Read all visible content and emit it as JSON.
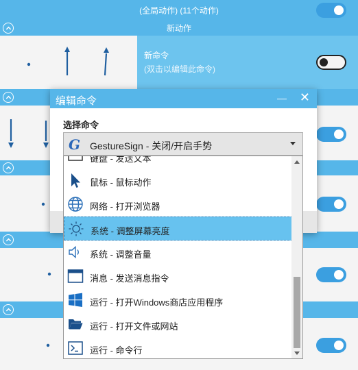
{
  "header": {
    "title": "(全局动作)  (11个动作)",
    "toggle_on": true
  },
  "groups": [
    {
      "title": "新动作"
    }
  ],
  "selected_action": {
    "name": "新命令",
    "hint": "(双击以编辑此命令)",
    "enabled": false
  },
  "actions": [
    {
      "enabled": true
    },
    {
      "enabled": true
    },
    {
      "enabled": true
    },
    {
      "enabled": true
    }
  ],
  "dialog": {
    "title": "编辑命令",
    "minimize_glyph": "—",
    "close_glyph": "✕",
    "section_label": "选择命令",
    "selected_value": "GestureSign - 关闭/开启手势",
    "logo_letter": "G",
    "items": [
      {
        "label": "键盘 - 发送文本",
        "icon": "keyboard-icon"
      },
      {
        "label": "鼠标 - 鼠标动作",
        "icon": "cursor-icon"
      },
      {
        "label": "网络 - 打开浏览器",
        "icon": "globe-icon"
      },
      {
        "label": "系统 - 调整屏幕亮度",
        "icon": "brightness-icon",
        "highlighted": true
      },
      {
        "label": "系统 - 调整音量",
        "icon": "speaker-icon"
      },
      {
        "label": "消息 - 发送消息指令",
        "icon": "window-icon"
      },
      {
        "label": "运行 - 打开Windows商店应用程序",
        "icon": "windows-logo-icon"
      },
      {
        "label": "运行 - 打开文件或网站",
        "icon": "folder-icon"
      },
      {
        "label": "运行 - 命令行",
        "icon": "terminal-icon"
      }
    ]
  },
  "colors": {
    "accent": "#56b6e9",
    "accent_light": "#6dc4ee",
    "toggle": "#3b9fe0"
  }
}
